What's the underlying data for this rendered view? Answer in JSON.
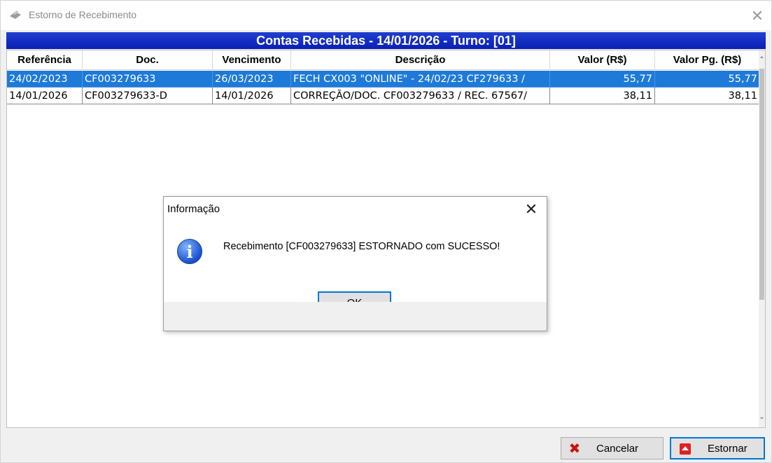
{
  "window": {
    "title": "Estorno de Recebimento",
    "close_glyph": "✕"
  },
  "banner": {
    "text": "Contas Recebidas - 14/01/2026 - Turno: [01]"
  },
  "grid": {
    "columns": [
      "Referência",
      "Doc.",
      "Vencimento",
      "Descrição",
      "Valor (R$)",
      "Valor Pg. (R$)"
    ],
    "rows": [
      [
        "24/02/2023",
        "CF003279633",
        "26/03/2023",
        "FECH CX003 \"ONLINE\" - 24/02/23 CF279633 /",
        "55,77",
        "55,77"
      ],
      [
        "14/01/2026",
        "CF003279633-D",
        "14/01/2026",
        "CORREÇÃO/DOC. CF003279633 / REC. 67567/",
        "38,11",
        "38,11"
      ]
    ],
    "selected_row": 0
  },
  "buttons": {
    "cancel_label": "Cancelar",
    "estornar_label": "Estornar"
  },
  "dialog": {
    "title": "Informação",
    "close_glyph": "✕",
    "message": "Recebimento [CF003279633] ESTORNADO com SUCESSO!",
    "ok_label": "OK",
    "icon": "info-icon"
  },
  "colors": {
    "banner": "#0a1fb4",
    "selection": "#1e7ad8",
    "focus_border": "#0078d7",
    "cancel_icon": "#d11010",
    "estornar_icon": "#e02020"
  }
}
